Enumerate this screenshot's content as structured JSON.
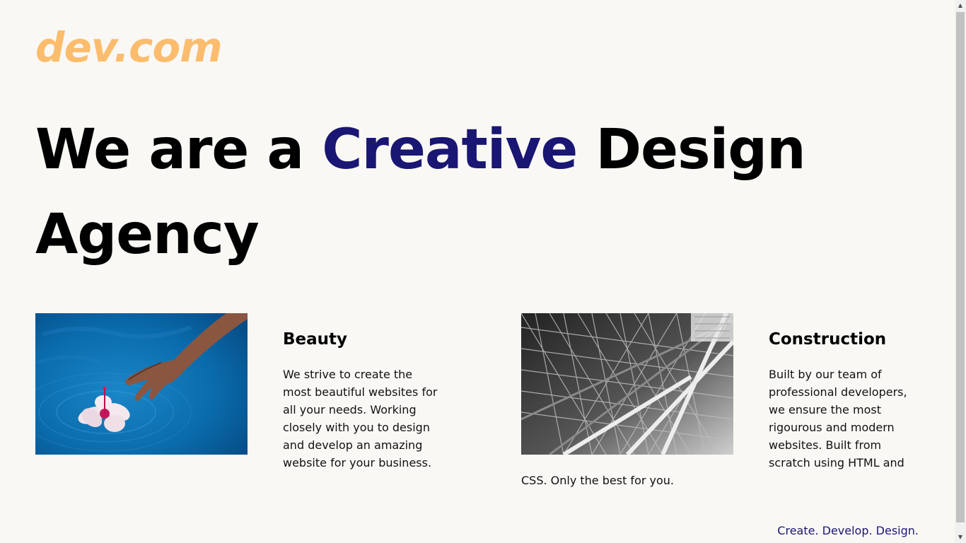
{
  "brand": {
    "logo": "dev.com"
  },
  "hero": {
    "line_part1": "We are a ",
    "accent_word": "Creative",
    "line_part2": " Design Agency"
  },
  "cards": [
    {
      "title": "Beauty",
      "text": "We strive to create the most beautiful websites for all your needs. Working closely with you to design and develop an amazing website for your business.",
      "image": "hand-touching-flower-in-water"
    },
    {
      "title": "Construction",
      "text": "Built by our team of professional developers, we ensure the most rigourous and modern websites. Built from scratch using HTML and",
      "text_continued": "CSS. Only the best for you.",
      "image": "steel-structure-black-and-white"
    }
  ],
  "footer": {
    "tagline": "Create. Develop. Design."
  },
  "colors": {
    "logo": "#fbbd6d",
    "accent": "#1a1673",
    "background": "#faf8f5",
    "text": "#000000"
  }
}
